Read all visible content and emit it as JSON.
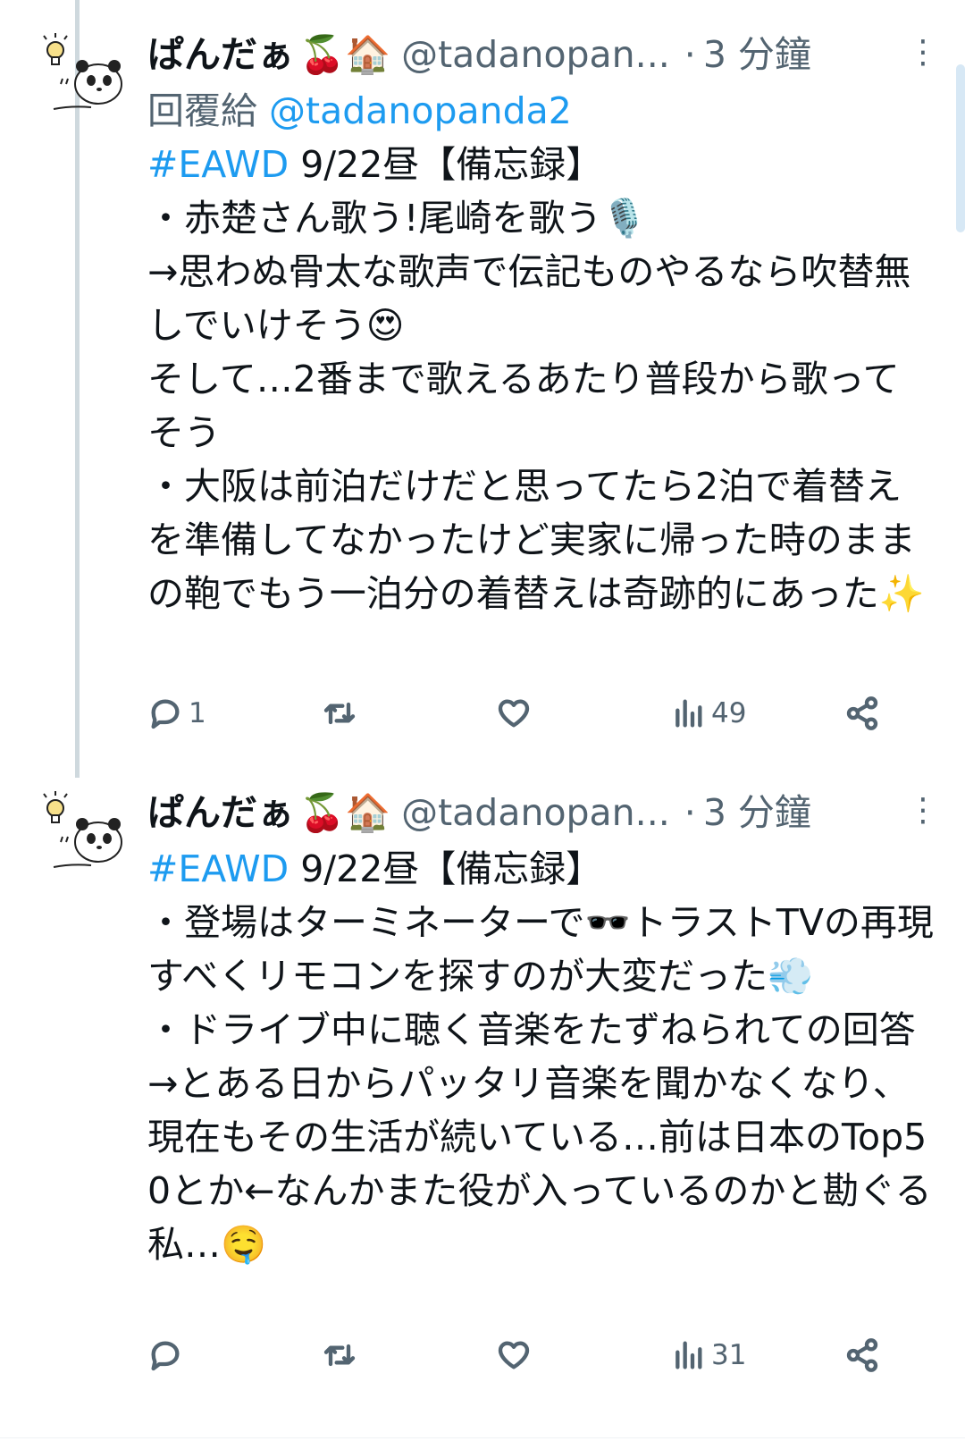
{
  "tweets": [
    {
      "display_name": "ぱんだぁ",
      "name_emojis": "🍒🏠",
      "handle": "@tadanopan...",
      "separator": "·",
      "time": "3 分鐘",
      "more_icon": "more-vertical-icon",
      "reply_prefix": "回覆給",
      "reply_handle": "@tadanopanda2",
      "hashtag": "#EAWD",
      "body_first_line": " 9/22昼【備忘録】",
      "body_rest": "・赤楚さん歌う!尾崎を歌う🎙️\n→思わぬ骨太な歌声で伝記ものやるなら吹替無しでいけそう😍\nそして…2番まで歌えるあたり普段から歌ってそう\n・大阪は前泊だけだと思ってたら2泊で着替えを準備してなかったけど実家に帰った時のままの鞄でもう一泊分の着替えは奇跡的にあった✨",
      "stats": {
        "replies": "1",
        "retweets": "",
        "likes": "",
        "views": "49"
      }
    },
    {
      "display_name": "ぱんだぁ",
      "name_emojis": "🍒🏠",
      "handle": "@tadanopan...",
      "separator": "·",
      "time": "3 分鐘",
      "more_icon": "more-vertical-icon",
      "hashtag": "#EAWD",
      "body_first_line": " 9/22昼【備忘録】",
      "body_rest": "・登場はターミネーターで🕶️トラストTVの再現すべくリモコンを探すのが大変だった💨\n・ドライブ中に聴く音楽をたずねられての回答→とある日からパッタリ音楽を聞かなくなり、現在もその生活が続いている…前は日本のTop50とか←なんかまた役が入っているのかと勘ぐる私…🤤",
      "stats": {
        "replies": "",
        "retweets": "",
        "likes": "",
        "views": "31"
      }
    }
  ],
  "icons": [
    "reply-icon",
    "retweet-icon",
    "like-icon",
    "views-icon",
    "share-icon"
  ],
  "colors": {
    "link": "#1d9bf0",
    "secondary_text": "#536471",
    "primary_text": "#0f1419",
    "thread_line": "#cfd9de"
  }
}
